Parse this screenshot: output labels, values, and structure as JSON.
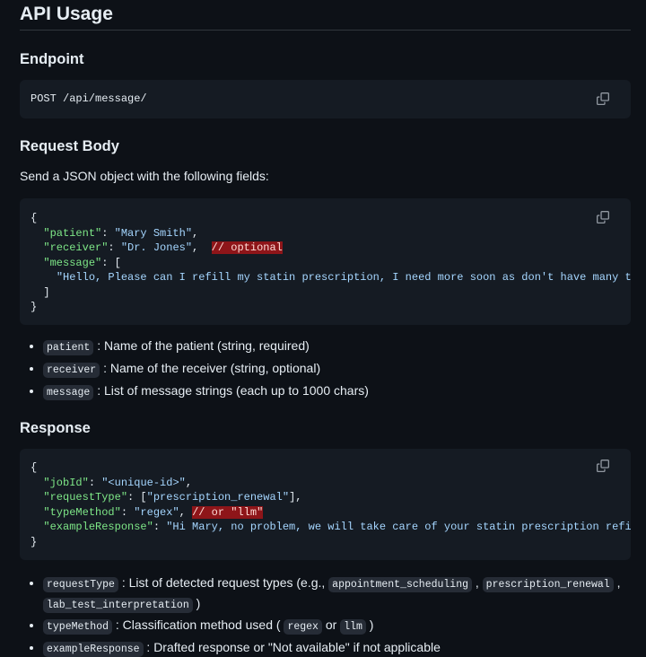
{
  "title": "API Usage",
  "endpoint": {
    "heading": "Endpoint",
    "code": "POST /api/message/"
  },
  "request": {
    "heading": "Request Body",
    "intro": "Send a JSON object with the following fields:",
    "code": {
      "open": "{",
      "patient_key": "\"patient\"",
      "patient_val": "\"Mary Smith\"",
      "receiver_key": "\"receiver\"",
      "receiver_val": "\"Dr. Jones\"",
      "receiver_comment": "// optional",
      "message_key": "\"message\"",
      "message_open": "[",
      "message_val": "\"Hello, Please can I refill my statin prescription, I need more soon as don't have many tablets left\"",
      "message_close": "]",
      "close": "}"
    },
    "fields": [
      {
        "name": "patient",
        "desc": ": Name of the patient (string, required)"
      },
      {
        "name": "receiver",
        "desc": ": Name of the receiver (string, optional)"
      },
      {
        "name": "message",
        "desc": ": List of message strings (each up to 1000 chars)"
      }
    ]
  },
  "response": {
    "heading": "Response",
    "code": {
      "open": "{",
      "jobId_key": "\"jobId\"",
      "jobId_val": "\"<unique-id>\"",
      "requestType_key": "\"requestType\"",
      "requestType_val": "\"prescription_renewal\"",
      "typeMethod_key": "\"typeMethod\"",
      "typeMethod_val": "\"regex\"",
      "typeMethod_comment": "// or \"llm\"",
      "exampleResponse_key": "\"exampleResponse\"",
      "exampleResponse_val": "\"Hi Mary, no problem, we will take care of your statin prescription refill request\"",
      "close": "}"
    },
    "fields": {
      "requestType": {
        "name": "requestType",
        "desc": ": List of detected request types (e.g.,",
        "ex1": "appointment_scheduling",
        "ex2": "prescription_renewal",
        "ex3": "lab_test_interpretation",
        "tail": ")"
      },
      "typeMethod": {
        "name": "typeMethod",
        "desc": ": Classification method used (",
        "ex1": "regex",
        "or": "or",
        "ex2": "llm",
        "tail": ")"
      },
      "exampleResponse": {
        "name": "exampleResponse",
        "desc": ": Drafted response or \"Not available\" if not applicable"
      }
    }
  },
  "icons": {
    "copy": "copy-icon"
  }
}
